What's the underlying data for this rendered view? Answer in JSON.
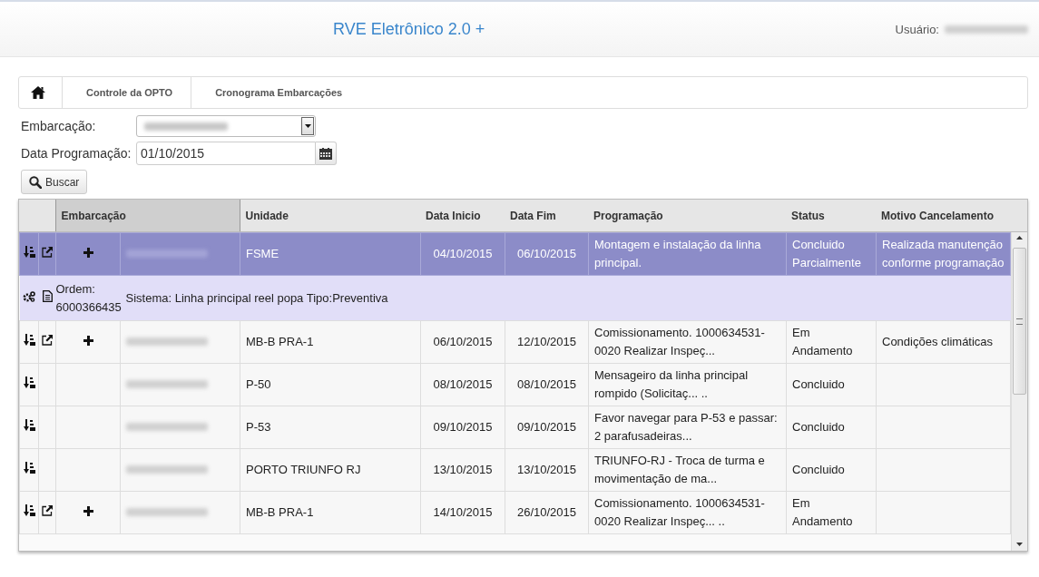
{
  "header": {
    "title": "RVE Eletrônico 2.0 +",
    "user_label": "Usuário:"
  },
  "breadcrumb": [
    "Controle da OPTO",
    "Cronograma Embarcações"
  ],
  "form": {
    "embarcacao_label": "Embarcação:",
    "data_label": "Data Programação:",
    "data_value": "01/10/2015",
    "search_button": "Buscar"
  },
  "table": {
    "columns": [
      {
        "label": "Embarcação",
        "sorted": true
      },
      {
        "label": "Unidade",
        "sorted": false
      },
      {
        "label": "Data Inicio",
        "sorted": false
      },
      {
        "label": "Data Fim",
        "sorted": false
      },
      {
        "label": "Programação",
        "sorted": false
      },
      {
        "label": "Status",
        "sorted": false
      },
      {
        "label": "Motivo Cancelamento",
        "sorted": false
      }
    ],
    "rows": [
      {
        "kind": "item",
        "selected": true,
        "external": true,
        "add": true,
        "unidade": "FSME",
        "data_inicio": "04/10/2015",
        "data_fim": "06/10/2015",
        "programacao": "Montagem e instalação da linha principal.",
        "status": "Concluido Parcialmente",
        "motivo": "Realizada manutenção conforme programação"
      },
      {
        "kind": "detail",
        "ordem_label": "Ordem:",
        "ordem": "6000366435",
        "text": "Sistema: Linha principal reel popa Tipo:Preventiva"
      },
      {
        "kind": "item",
        "selected": false,
        "external": true,
        "add": true,
        "unidade": "MB-B PRA-1",
        "data_inicio": "06/10/2015",
        "data_fim": "12/10/2015",
        "programacao": "Comissionamento. 1000634531-0020 Realizar Inspeç...",
        "status": "Em Andamento",
        "motivo": "Condições climáticas"
      },
      {
        "kind": "item",
        "selected": false,
        "external": false,
        "add": false,
        "unidade": "P-50",
        "data_inicio": "08/10/2015",
        "data_fim": "08/10/2015",
        "programacao": "Mensageiro da linha principal rompido (Solicitaç... ..",
        "status": "Concluido"
      },
      {
        "kind": "item",
        "selected": false,
        "external": false,
        "add": false,
        "unidade": "P-53",
        "data_inicio": "09/10/2015",
        "data_fim": "09/10/2015",
        "programacao": "Favor navegar para P-53 e passar: 2 parafusadeiras...",
        "status": "Concluido"
      },
      {
        "kind": "item",
        "selected": false,
        "external": false,
        "add": false,
        "unidade": "PORTO TRIUNFO RJ",
        "data_inicio": "13/10/2015",
        "data_fim": "13/10/2015",
        "programacao": "TRIUNFO-RJ - Troca de turma e movimentação de ma...",
        "status": "Concluido"
      },
      {
        "kind": "item",
        "selected": false,
        "external": true,
        "add": true,
        "unidade": "MB-B PRA-1",
        "data_inicio": "14/10/2015",
        "data_fim": "26/10/2015",
        "programacao": "Comissionamento. 1000634531-0020 Realizar Inspeç... ..",
        "status": "Em Andamento"
      }
    ]
  }
}
